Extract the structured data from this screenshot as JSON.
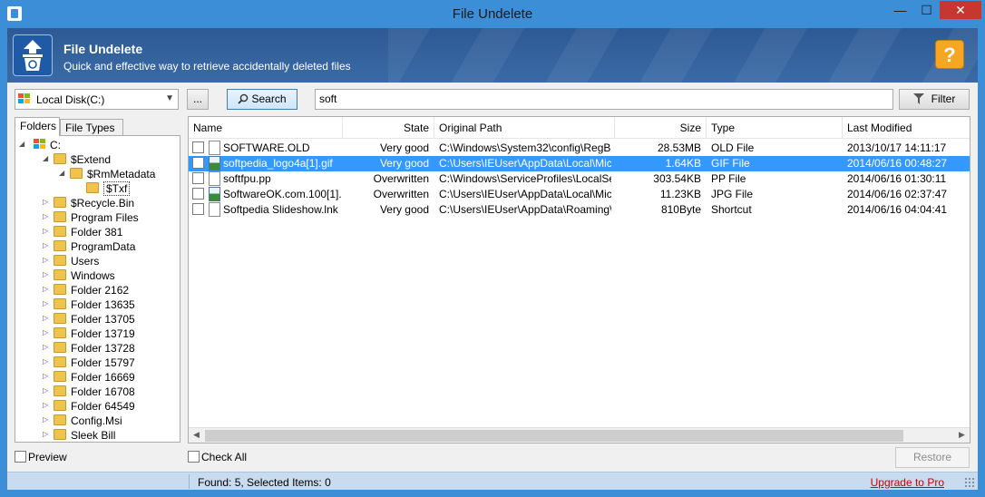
{
  "window": {
    "title": "File Undelete"
  },
  "banner": {
    "title": "File Undelete",
    "subtitle": "Quick and effective way to retrieve accidentally deleted files",
    "help_label": "?"
  },
  "toolbar": {
    "drive": "Local Disk(C:)",
    "browse_label": "...",
    "search_label": "Search",
    "search_value": "soft",
    "filter_label": "Filter"
  },
  "left_tabs": {
    "folders": "Folders",
    "file_types": "File Types"
  },
  "tree": [
    {
      "label": "C:",
      "depth": 0,
      "expanded": true
    },
    {
      "label": "$Extend",
      "depth": 1,
      "expanded": true
    },
    {
      "label": "$RmMetadata",
      "depth": 2,
      "expanded": true
    },
    {
      "label": "$Txf",
      "depth": 3,
      "expanded": false
    },
    {
      "label": "$Recycle.Bin",
      "depth": 1,
      "expanded": false
    },
    {
      "label": "Program Files",
      "depth": 1,
      "expanded": false
    },
    {
      "label": "Folder 381",
      "depth": 1,
      "expanded": false
    },
    {
      "label": "ProgramData",
      "depth": 1,
      "expanded": false
    },
    {
      "label": "Users",
      "depth": 1,
      "expanded": false
    },
    {
      "label": "Windows",
      "depth": 1,
      "expanded": false
    },
    {
      "label": "Folder 2162",
      "depth": 1,
      "expanded": false
    },
    {
      "label": "Folder 13635",
      "depth": 1,
      "expanded": false
    },
    {
      "label": "Folder 13705",
      "depth": 1,
      "expanded": false
    },
    {
      "label": "Folder 13719",
      "depth": 1,
      "expanded": false
    },
    {
      "label": "Folder 13728",
      "depth": 1,
      "expanded": false
    },
    {
      "label": "Folder 15797",
      "depth": 1,
      "expanded": false
    },
    {
      "label": "Folder 16669",
      "depth": 1,
      "expanded": false
    },
    {
      "label": "Folder 16708",
      "depth": 1,
      "expanded": false
    },
    {
      "label": "Folder 64549",
      "depth": 1,
      "expanded": false
    },
    {
      "label": "Config.Msi",
      "depth": 1,
      "expanded": false
    },
    {
      "label": "Sleek Bill",
      "depth": 1,
      "expanded": false
    }
  ],
  "columns": [
    "Name",
    "State",
    "Original Path",
    "Size",
    "Type",
    "Last Modified"
  ],
  "files": [
    {
      "name": "SOFTWARE.OLD",
      "state": "Very good",
      "path": "C:\\Windows\\System32\\config\\RegB...",
      "size": "28.53MB",
      "type": "OLD File",
      "modified": "2013/10/17 14:11:17",
      "icon": "document-icon",
      "selected": false
    },
    {
      "name": "softpedia_logo4a[1].gif",
      "state": "Very good",
      "path": "C:\\Users\\IEUser\\AppData\\Local\\Micr...",
      "size": "1.64KB",
      "type": "GIF File",
      "modified": "2014/06/16 00:48:27",
      "icon": "image-icon",
      "selected": true
    },
    {
      "name": "softfpu.pp",
      "state": "Overwritten",
      "path": "C:\\Windows\\ServiceProfiles\\LocalSer...",
      "size": "303.54KB",
      "type": "PP File",
      "modified": "2014/06/16 01:30:11",
      "icon": "document-icon",
      "selected": false
    },
    {
      "name": "SoftwareOK.com.100[1]...",
      "state": "Overwritten",
      "path": "C:\\Users\\IEUser\\AppData\\Local\\Micr...",
      "size": "11.23KB",
      "type": "JPG File",
      "modified": "2014/06/16 02:37:47",
      "icon": "image-icon",
      "selected": false
    },
    {
      "name": "Softpedia Slideshow.lnk",
      "state": "Very good",
      "path": "C:\\Users\\IEUser\\AppData\\Roaming\\...",
      "size": "810Byte",
      "type": "Shortcut",
      "modified": "2014/06/16 04:04:41",
      "icon": "document-icon",
      "selected": false
    }
  ],
  "bottom": {
    "preview_label": "Preview",
    "check_all_label": "Check All",
    "restore_label": "Restore"
  },
  "status": {
    "found_text": "Found: 5, Selected Items: 0",
    "upgrade_label": "Upgrade to Pro"
  },
  "colors": {
    "accent": "#3c8fd6",
    "selection": "#3399ff",
    "help": "#f5a623",
    "upgrade": "#cc0000"
  }
}
